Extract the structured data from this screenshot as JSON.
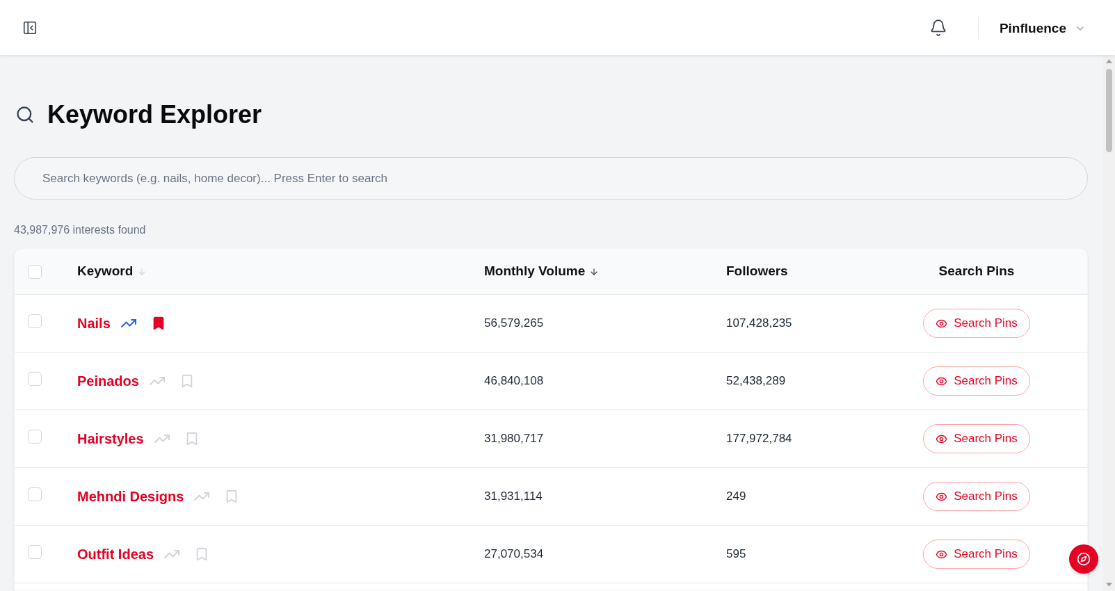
{
  "header": {
    "account": {
      "name": "Pinfluence"
    }
  },
  "page": {
    "title": "Keyword Explorer"
  },
  "search": {
    "placeholder": "Search keywords (e.g. nails, home decor)... Press Enter to search"
  },
  "result_count": "43,987,976 interests found",
  "table": {
    "select_all": {
      "checked": false
    },
    "columns": [
      {
        "label": "Keyword",
        "sortable": true,
        "sorted": false
      },
      {
        "label": "Monthly Volume",
        "sortable": true,
        "sorted": true
      },
      {
        "label": "Followers"
      },
      {
        "label": "Search Pins"
      }
    ],
    "rows": [
      {
        "checked": false,
        "keyword": "Nails",
        "trending": true,
        "saved": true,
        "monthly_volume": "56,579,265",
        "followers": "107,428,235",
        "action": "Search Pins"
      },
      {
        "checked": false,
        "keyword": "Peinados",
        "trending": false,
        "saved": false,
        "monthly_volume": "46,840,108",
        "followers": "52,438,289",
        "action": "Search Pins"
      },
      {
        "checked": false,
        "keyword": "Hairstyles",
        "trending": false,
        "saved": false,
        "monthly_volume": "31,980,717",
        "followers": "177,972,784",
        "action": "Search Pins"
      },
      {
        "checked": false,
        "keyword": "Mehndi Designs",
        "trending": false,
        "saved": false,
        "monthly_volume": "31,931,114",
        "followers": "249",
        "action": "Search Pins"
      },
      {
        "checked": false,
        "keyword": "Outfit Ideas",
        "trending": false,
        "saved": false,
        "monthly_volume": "27,070,534",
        "followers": "595",
        "action": "Search Pins"
      }
    ]
  }
}
